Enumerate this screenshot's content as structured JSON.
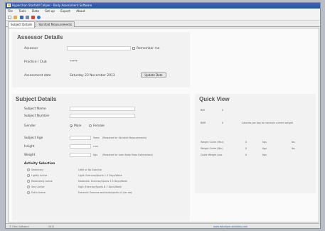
{
  "window": {
    "title": "Hyperchon Starfold Caliper - Body Assessment Software"
  },
  "menu": [
    "File",
    "Tools",
    "Data",
    "Set-up",
    "Export",
    "About"
  ],
  "toolbar": {
    "icons": [
      "new-icon",
      "open-icon",
      "save-icon",
      "print-icon",
      "delete-icon",
      "help-icon"
    ],
    "colors": [
      "#ffffff",
      "#e2b03c",
      "#3a66b8",
      "#7a8aa0",
      "#c44a3e",
      "#2f77d2"
    ]
  },
  "tabs": [
    "Subject Details",
    "Skinfold Measurements"
  ],
  "assessor": {
    "title": "Assessor Details",
    "assessor_label": "Assessor",
    "remember_label": "Remember me",
    "practice_label": "Practice  /  Club",
    "practice_value": "*****",
    "date_label": "Assessment date",
    "date_value": "Saturday 23 November 2013",
    "update_button": "Update Date"
  },
  "subject": {
    "title": "Subject Details",
    "name_label": "Subject Name",
    "number_label": "Subject Number",
    "gender_label": "Gender",
    "male_label": "Male",
    "female_label": "Female",
    "age_label": "Subject Age",
    "age_unit": "Years",
    "age_note": "(Required for Skinfold Measurements)",
    "height_label": "Height",
    "height_unit": "cms",
    "weight_label": "Weight",
    "weight_unit": "Kgs",
    "weight_note": "(Required for Lean Body Mass Estimations)",
    "activity_title": "Activity Selection",
    "activities": [
      {
        "name": "Sedentary",
        "desc": "Little or No Exercise"
      },
      {
        "name": "Lightly Active",
        "desc": "Light: Exercise/Sports 1-3 Days/Week"
      },
      {
        "name": "Moderately Active",
        "desc": "Moderate: Exercise/Sports 3-5 Days/Week"
      },
      {
        "name": "Very Active",
        "desc": "High: Exercise/Sports 6-7 Days/Week"
      },
      {
        "name": "Extra Active",
        "desc": "Extreme: Exercise workouts/sports x2 per day"
      }
    ]
  },
  "quickview": {
    "title": "Quick View",
    "bmi_label": "BMI",
    "bmi_value": "0",
    "bmr_label": "BMR",
    "bmr_value": "0",
    "bmr_note": "Calories per day to maintain current weight",
    "rows": [
      {
        "label": "Weight Guide (Max)",
        "a": "0",
        "unit_a": "Kgs",
        "b": "",
        "unit_b": "Ibs"
      },
      {
        "label": "Weight Guide (Min)",
        "a": "0",
        "unit_a": "Kgs",
        "b": "",
        "unit_b": "Ibs"
      },
      {
        "label": "Guide Weight Loss",
        "a": "0",
        "unit_a": "Kgs",
        "b": "",
        "unit_b": ""
      }
    ]
  },
  "status": {
    "left": "© Fitec Software",
    "version": "2011",
    "link": "www.fatcaliper-skinfolds.com"
  }
}
